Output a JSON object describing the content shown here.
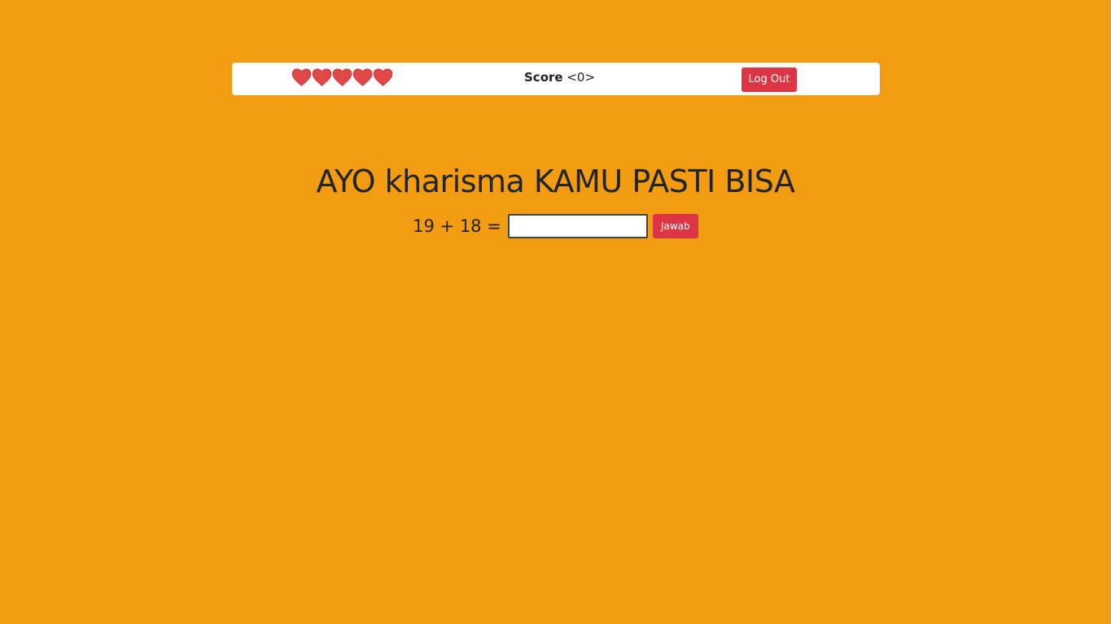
{
  "header": {
    "lives": [
      "heart-icon",
      "heart-icon",
      "heart-icon",
      "heart-icon",
      "heart-icon"
    ],
    "lives_count": 5,
    "score_label": "Score",
    "score_value": "<0>",
    "logout_label": "Log Out"
  },
  "main": {
    "heading": "AYO kharisma KAMU PASTI BISA",
    "equation": "19 + 18 =",
    "answer_value": "",
    "answer_placeholder": "",
    "submit_label": "Jawab"
  },
  "colors": {
    "background": "#f39c12",
    "accent": "#dc3545",
    "heart": "#e04848"
  }
}
